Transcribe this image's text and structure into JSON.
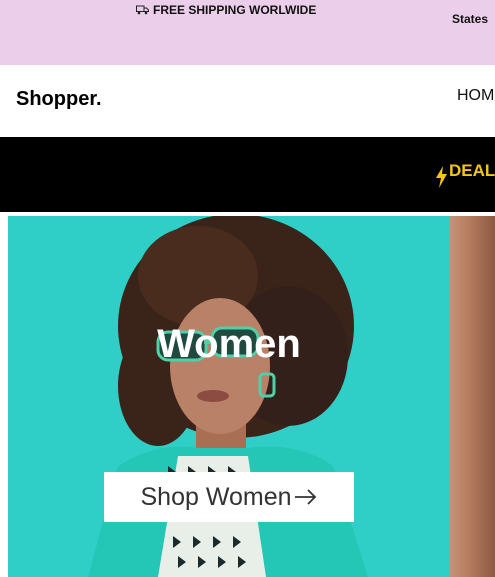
{
  "topbar": {
    "shipping_text": "FREE SHIPPING WORLWIDE",
    "shipping_icon": "truck-icon",
    "region_text": "States"
  },
  "navbar": {
    "logo": "Shopper.",
    "nav_items": [
      "HOM"
    ]
  },
  "deals_bar": {
    "text": "DEAL",
    "icon": "lightning-icon",
    "accent_color": "#f5c518"
  },
  "hero": {
    "title": "Women",
    "cta_label": "Shop Women",
    "cta_icon": "arrow-right-icon",
    "background_color": "#2fcfc8"
  },
  "colors": {
    "topbar_bg": "#ebcfea",
    "deals_bg": "#000000"
  }
}
